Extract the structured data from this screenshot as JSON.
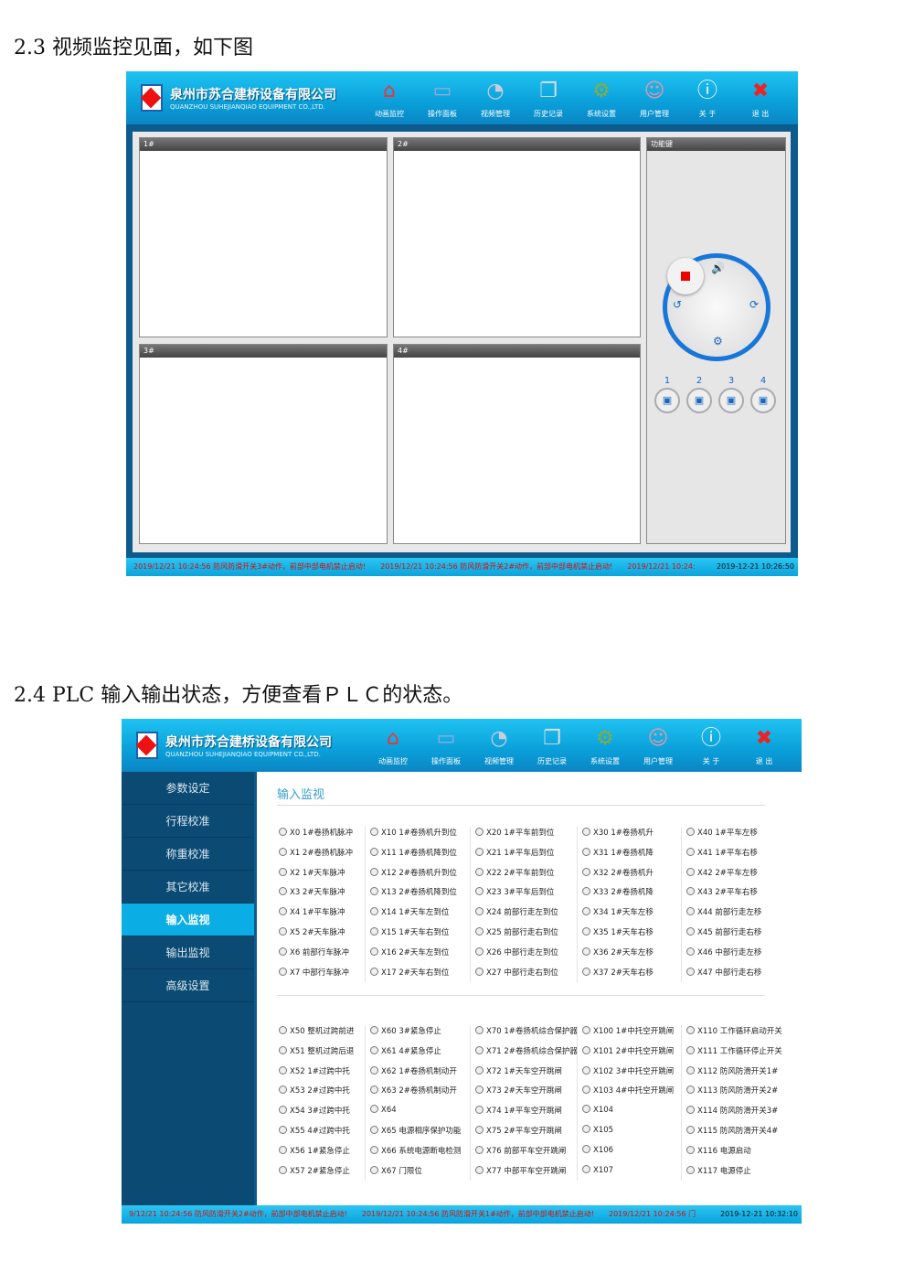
{
  "section1": {
    "heading": "2.3 视频监控见面，如下图"
  },
  "section2": {
    "heading": "2.4 PLC 输入输出状态，方便查看ＰＬＣ的状态。"
  },
  "app": {
    "company_cn": "泉州市苏合建桥设备有限公司",
    "company_en": "QUANZHOU SUHEJIANQIAO EQUIPMENT CO.,LTD.",
    "nav": [
      {
        "label": "动画监控",
        "icon": "home-icon"
      },
      {
        "label": "操作面板",
        "icon": "monitor-icon"
      },
      {
        "label": "视频管理",
        "icon": "camera-icon"
      },
      {
        "label": "历史记录",
        "icon": "windows-icon"
      },
      {
        "label": "系统设置",
        "icon": "gear-icon"
      },
      {
        "label": "用户管理",
        "icon": "user-icon"
      },
      {
        "label": "关 于",
        "icon": "info-icon"
      },
      {
        "label": "退 出",
        "icon": "close-icon"
      }
    ]
  },
  "video": {
    "panes": [
      "1#",
      "2#",
      "3#",
      "4#"
    ],
    "function_panel": "功能键",
    "camera_buttons": [
      "1",
      "2",
      "3",
      "4"
    ],
    "status": [
      "2019/12/21 10:24:56 防风防滑开关3#动作，前部中部电机禁止启动!",
      "2019/12/21 10:24:56 防风防滑开关2#动作，前部中部电机禁止启动!",
      "2019/12/21 10:24:"
    ],
    "clock": "2019-12-21 10:26:50"
  },
  "plc": {
    "sidebar": [
      "参数设定",
      "行程校准",
      "称重校准",
      "其它校准",
      "输入监视",
      "输出监视",
      "高级设置"
    ],
    "active": "输入监视",
    "title": "输入监视",
    "group1": [
      [
        "X0 1#卷扬机脉冲",
        "X1 2#卷扬机脉冲",
        "X2 1#天车脉冲",
        "X3 2#天车脉冲",
        "X4 1#平车脉冲",
        "X5 2#天车脉冲",
        "X6 前部行车脉冲",
        "X7 中部行车脉冲"
      ],
      [
        "X10 1#卷扬机升到位",
        "X11 1#卷扬机降到位",
        "X12 2#卷扬机升到位",
        "X13 2#卷扬机降到位",
        "X14 1#天车左到位",
        "X15 1#天车右到位",
        "X16 2#天车左到位",
        "X17 2#天车右到位"
      ],
      [
        "X20 1#平车前到位",
        "X21 1#平车后到位",
        "X22 2#平车前到位",
        "X23 3#平车后到位",
        "X24 前部行走左到位",
        "X25 前部行走右到位",
        "X26 中部行走左到位",
        "X27 中部行走右到位"
      ],
      [
        "X30 1#卷扬机升",
        "X31 1#卷扬机降",
        "X32 2#卷扬机升",
        "X33 2#卷扬机降",
        "X34 1#天车左移",
        "X35 1#天车右移",
        "X36 2#天车左移",
        "X37 2#天车右移"
      ],
      [
        "X40 1#平车左移",
        "X41 1#平车右移",
        "X42 2#平车左移",
        "X43 2#平车右移",
        "X44 前部行走左移",
        "X45 前部行走右移",
        "X46 中部行走左移",
        "X47 中部行走右移"
      ]
    ],
    "group2": [
      [
        "X50 整机过跨前进",
        "X51 整机过跨后退",
        "X52 1#过跨中托",
        "X53 2#过跨中托",
        "X54 3#过跨中托",
        "X55 4#过跨中托",
        "X56 1#紧急停止",
        "X57 2#紧急停止"
      ],
      [
        "X60 3#紧急停止",
        "X61 4#紧急停止",
        "X62 1#卷扬机制动开",
        "X63 2#卷扬机制动开",
        "X64",
        "X65 电源相序保护功能",
        "X66 系统电源断电检测",
        "X67 门限位"
      ],
      [
        "X70 1#卷扬机综合保护器",
        "X71 2#卷扬机综合保护器",
        "X72 1#天车空开跳闸",
        "X73 2#天车空开跳闸",
        "X74 1#平车空开跳闸",
        "X75 2#平车空开跳闸",
        "X76 前部平车空开跳闸",
        "X77 中部平车空开跳闸"
      ],
      [
        "X100 1#中托空开跳闸",
        "X101 2#中托空开跳闸",
        "X102 3#中托空开跳闸",
        "X103 4#中托空开跳闸",
        "X104",
        "X105",
        "X106",
        "X107"
      ],
      [
        "X110 工作循环启动开关",
        "X111 工作循环停止开关",
        "X112 防风防滑开关1#",
        "X113 防风防滑开关2#",
        "X114 防风防滑开关3#",
        "X115 防风防滑开关4#",
        "X116 电源启动",
        "X117 电源停止"
      ]
    ],
    "status": [
      "9/12/21 10:24:56 防风防滑开关2#动作，前部中部电机禁止启动!",
      "2019/12/21 10:24:56 防风防滑开关1#动作，前部中部电机禁止启动!",
      "2019/12/21 10:24:56 门"
    ],
    "clock": "2019-12-21 10:32:10"
  },
  "colors": {
    "header": "#0aa3dc",
    "sidebar": "#0b4a72",
    "sidebar_active": "#0aaee5",
    "alarm_text": "#d01010"
  }
}
